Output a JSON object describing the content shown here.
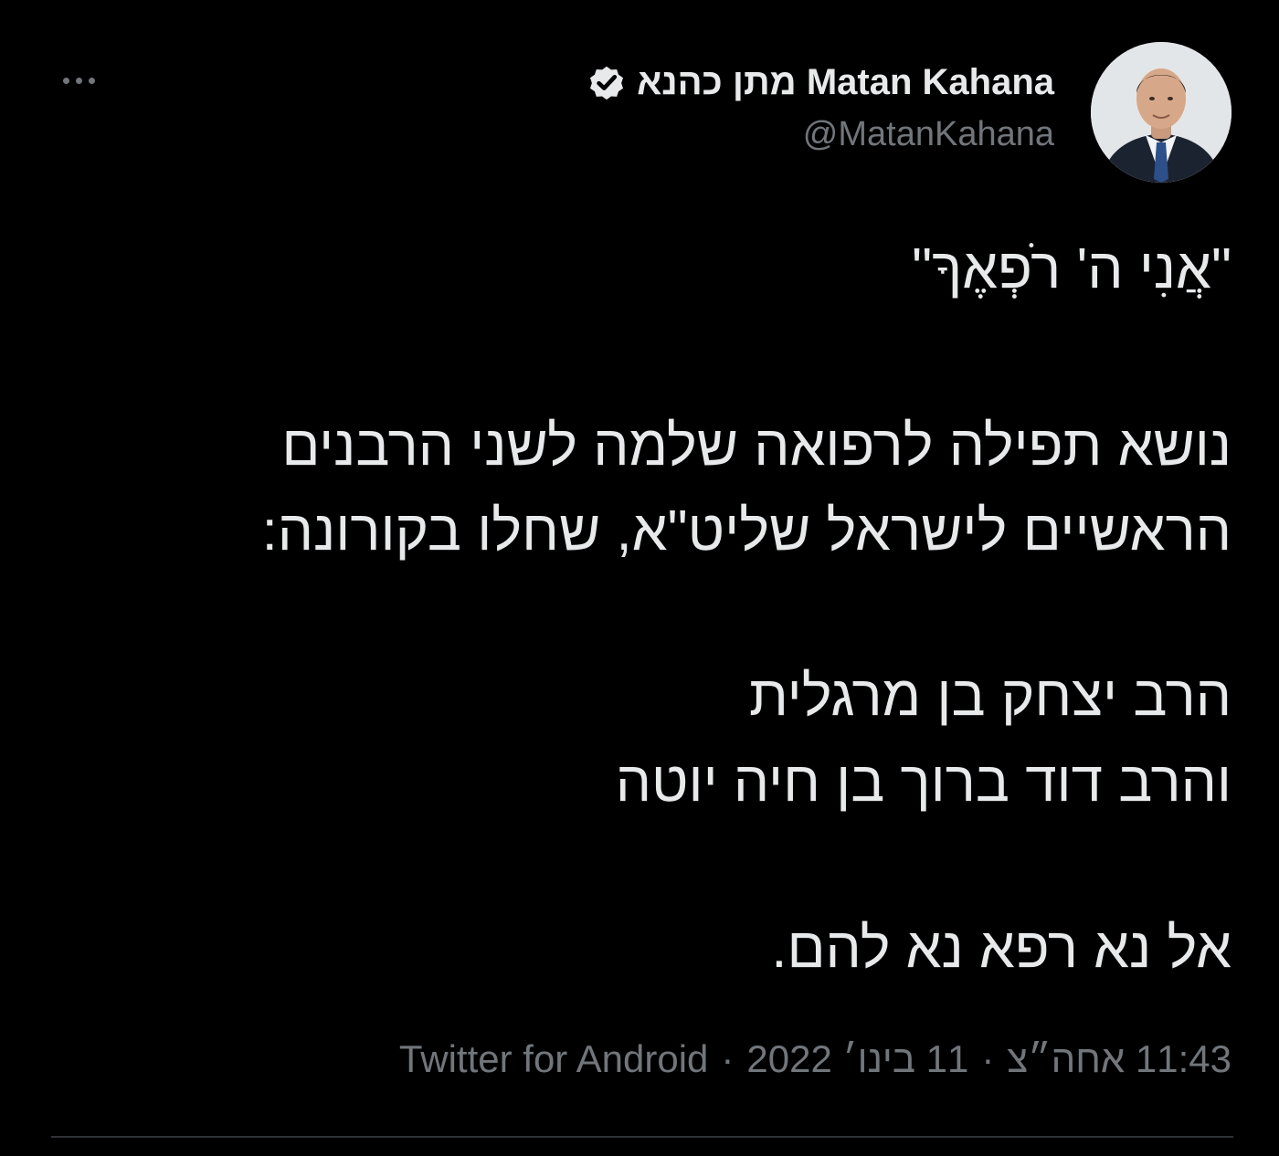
{
  "header": {
    "display_name": "Matan Kahana מתן כהנא",
    "handle": "@MatanKahana"
  },
  "tweet": {
    "lines": [
      "\"אֲנִי ה' רֹפְאֶךָ\"",
      "נושא תפילה לרפואה שלמה לשני הרבנים",
      "הראשיים לישראל שליט\"א, שחלו בקורונה:",
      "הרב יצחק בן מרגלית",
      "והרב דוד ברוך בן חיה יוטה",
      "אל נא רפא נא להם."
    ]
  },
  "meta": {
    "time": "11:43 אחה״צ",
    "date": "11 בינו׳ 2022",
    "separator": "·",
    "source": "Twitter for Android"
  },
  "icons": {
    "more": "more-horizontal-icon",
    "verified": "verified-badge-icon"
  },
  "colors": {
    "background": "#000000",
    "text": "#e7e9ea",
    "secondary": "#71767b",
    "divider": "#2f3336"
  }
}
